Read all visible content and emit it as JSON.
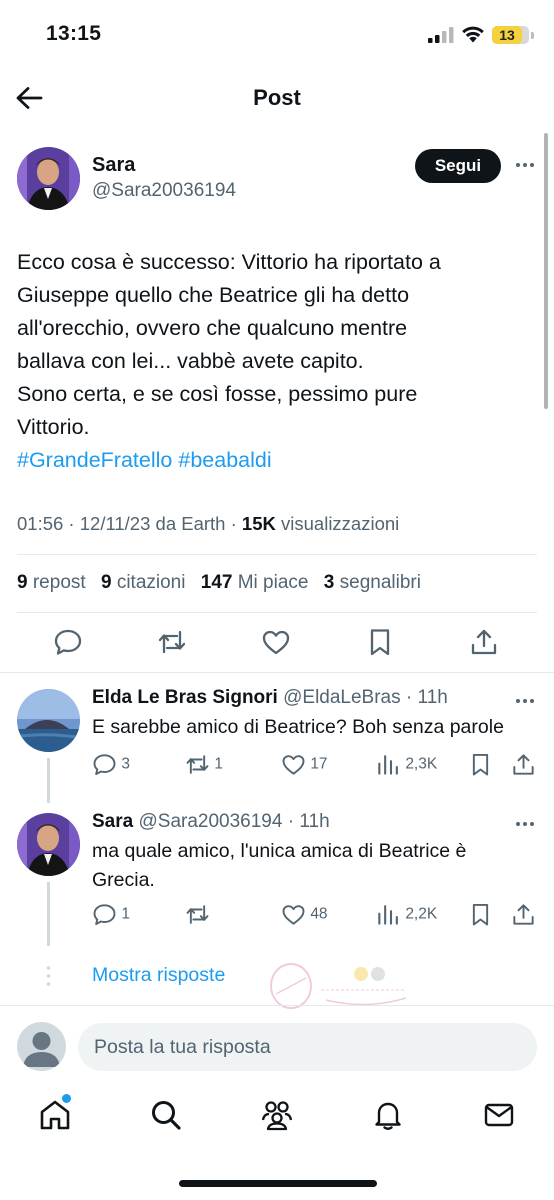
{
  "status_bar": {
    "time": "13:15",
    "battery_level": "13"
  },
  "header": {
    "title": "Post"
  },
  "post": {
    "author_name": "Sara",
    "author_handle": "@Sara20036194",
    "follow_label": "Segui",
    "text_lines": [
      "Ecco cosa è successo: Vittorio ha riportato a",
      "Giuseppe quello che Beatrice gli ha detto",
      "all'orecchio, ovvero che qualcuno mentre",
      "ballava con lei... vabbè avete capito.",
      "Sono certa, e se così fosse, pessimo pure",
      "Vittorio."
    ],
    "hashtags": [
      "#GrandeFratello",
      "#beabaldi"
    ],
    "meta": {
      "time": "01:56",
      "date": "12/11/23",
      "source": "da Earth",
      "views": "15K",
      "views_label": "visualizzazioni"
    },
    "stats": {
      "reposts": "9",
      "reposts_label": "repost",
      "quotes": "9",
      "quotes_label": "citazioni",
      "likes": "147",
      "likes_label": "Mi piace",
      "bookmarks": "3",
      "bookmarks_label": "segnalibri"
    }
  },
  "replies": [
    {
      "name": "Elda Le Bras Signori",
      "handle": "@EldaLeBras",
      "time": "11h",
      "text": "E sarebbe amico di Beatrice? Boh senza parole",
      "comments": "3",
      "reposts": "1",
      "likes": "17",
      "views": "2,3K"
    },
    {
      "name": "Sara",
      "handle": "@Sara20036194",
      "time": "11h",
      "text_lines": [
        "ma quale amico, l'unica amica di Beatrice è",
        "Grecia."
      ],
      "comments": "1",
      "reposts": "",
      "likes": "48",
      "views": "2,2K"
    }
  ],
  "show_replies_label": "Mostra risposte",
  "composer": {
    "placeholder": "Posta la tua risposta"
  },
  "bottom_nav": [
    "home-icon",
    "search-icon",
    "communities-icon",
    "notifications-icon",
    "messages-icon"
  ],
  "colors": {
    "accent": "#1d9bf0",
    "text": "#0f1419",
    "secondary": "#536471",
    "divider": "#e7e9ea"
  }
}
